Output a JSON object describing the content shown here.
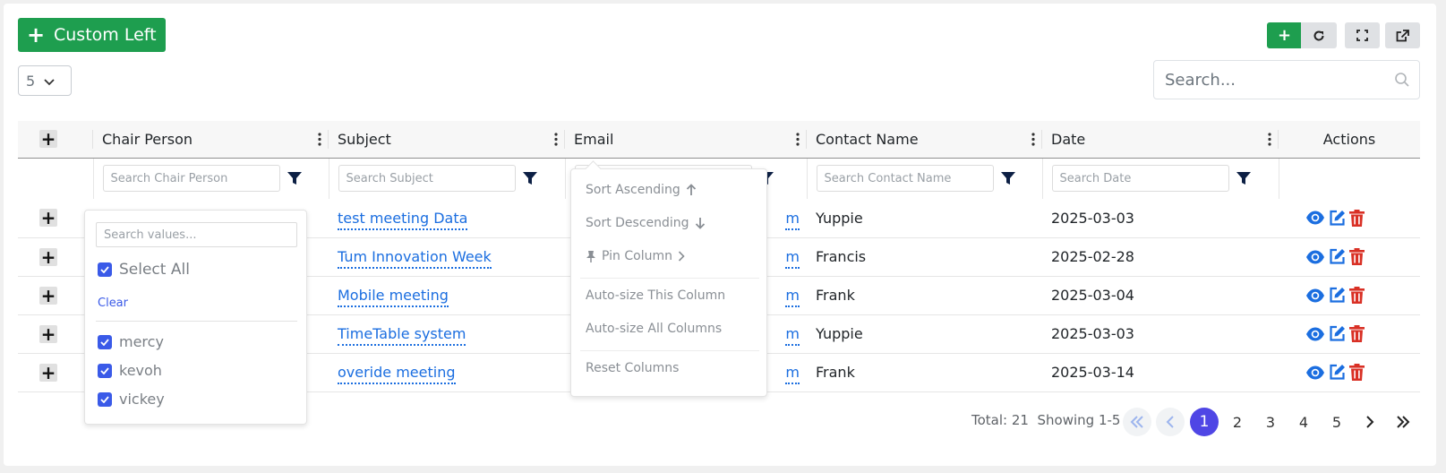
{
  "toolbar": {
    "custom_left_label": "Custom Left",
    "page_size": "5",
    "search_placeholder": "Search..."
  },
  "table": {
    "columns": [
      "Chair Person",
      "Subject",
      "Email",
      "Contact Name",
      "Date",
      "Actions"
    ],
    "filters": {
      "chair_person": "Search Chair Person",
      "subject": "Search Subject",
      "contact_name": "Search Contact Name",
      "date": "Search Date"
    },
    "rows": [
      {
        "subject": "test meeting Data",
        "email_fragment": "m",
        "contact": "Yuppie",
        "date": "2025-03-03"
      },
      {
        "subject": "Tum Innovation Week",
        "email_fragment": "m",
        "contact": "Francis",
        "date": "2025-02-28"
      },
      {
        "subject": "Mobile meeting",
        "email_fragment": "m",
        "contact": "Frank",
        "date": "2025-03-04"
      },
      {
        "subject": "TimeTable system",
        "email_fragment": "m",
        "contact": "Yuppie",
        "date": "2025-03-03"
      },
      {
        "subject": "overide meeting",
        "email_fragment": "m",
        "contact": "Frank",
        "date": "2025-03-14"
      }
    ]
  },
  "value_filter": {
    "search_placeholder": "Search values...",
    "select_all": "Select All",
    "clear": "Clear",
    "values": [
      "mercy",
      "kevoh",
      "vickey"
    ]
  },
  "column_menu": {
    "sort_asc": "Sort Ascending",
    "sort_desc": "Sort Descending",
    "pin": "Pin Column",
    "autosize_this": "Auto-size This Column",
    "autosize_all": "Auto-size All Columns",
    "reset": "Reset Columns"
  },
  "pagination": {
    "total": "Total: 21",
    "showing": "Showing 1-5",
    "pages": [
      "1",
      "2",
      "3",
      "4",
      "5"
    ],
    "current": "1"
  },
  "colors": {
    "primary_green": "#1e9e4f",
    "link_blue": "#1b6ee0",
    "active_page": "#4f46e5",
    "delete_red": "#d93025",
    "checkbox_blue": "#3a5ae8"
  }
}
